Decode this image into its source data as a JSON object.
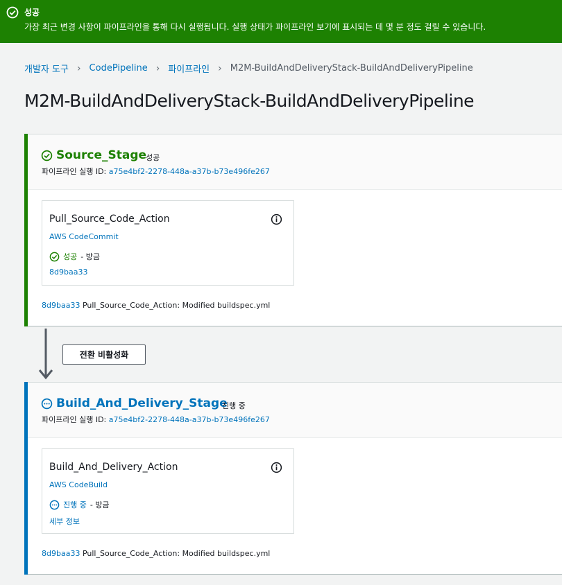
{
  "flash": {
    "title": "성공",
    "message": "가장 최근 변경 사항이 파이프라인을 통해 다시 실행됩니다. 실행 상태가 파이프라인 보기에 표시되는 데 몇 분 정도 걸릴 수 있습니다.",
    "icon": "check-circle-icon",
    "color": "#1d8102"
  },
  "breadcrumbs": [
    {
      "label": "개발자 도구"
    },
    {
      "label": "CodePipeline"
    },
    {
      "label": "파이프라인"
    },
    {
      "label": "M2M-BuildAndDeliveryStack-BuildAndDeliveryPipeline"
    }
  ],
  "page_title": "M2M-BuildAndDeliveryStack-BuildAndDeliveryPipeline",
  "stages": [
    {
      "name": "Source_Stage",
      "status": "성공",
      "status_icon": "check-circle-icon",
      "color": "#1d8102",
      "exec_label": "파이프라인 실행 ID:",
      "exec_id": "a75e4bf2-2278-448a-a37b-b73e496fe267",
      "action": {
        "name": "Pull_Source_Code_Action",
        "provider": "AWS CodeCommit",
        "status": "성공",
        "time": "- 방금",
        "link": "8d9baa33"
      },
      "commit_id": "8d9baa33",
      "commit_msg": "Pull_Source_Code_Action: Modified buildspec.yml"
    },
    {
      "name": "Build_And_Delivery_Stage",
      "status": "진행 중",
      "status_icon": "in-progress-icon",
      "color": "#0073bb",
      "exec_label": "파이프라인 실행 ID:",
      "exec_id": "a75e4bf2-2278-448a-a37b-b73e496fe267",
      "action": {
        "name": "Build_And_Delivery_Action",
        "provider": "AWS CodeBuild",
        "status": "진행 중",
        "time": "- 방금",
        "link": "세부 정보"
      },
      "commit_id": "8d9baa33",
      "commit_msg": "Pull_Source_Code_Action: Modified buildspec.yml"
    }
  ],
  "transition_button": "전환 비활성화"
}
